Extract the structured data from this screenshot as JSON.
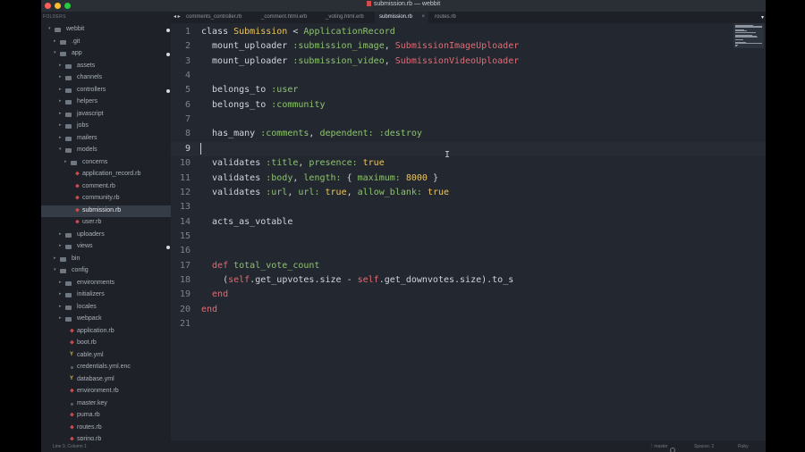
{
  "window": {
    "title": "submission.rb — webbit",
    "traffic_lights": [
      "#fc5f57",
      "#fdbc2e",
      "#28c840"
    ]
  },
  "sidebar": {
    "header": "FOLDERS",
    "items": [
      {
        "label": "webbit",
        "depth": 0,
        "kind": "folder-open",
        "dot": true
      },
      {
        "label": ".git",
        "depth": 1,
        "kind": "folder"
      },
      {
        "label": "app",
        "depth": 1,
        "kind": "folder-open",
        "dot": true
      },
      {
        "label": "assets",
        "depth": 2,
        "kind": "folder"
      },
      {
        "label": "channels",
        "depth": 2,
        "kind": "folder"
      },
      {
        "label": "controllers",
        "depth": 2,
        "kind": "folder",
        "dot": true
      },
      {
        "label": "helpers",
        "depth": 2,
        "kind": "folder"
      },
      {
        "label": "javascript",
        "depth": 2,
        "kind": "folder"
      },
      {
        "label": "jobs",
        "depth": 2,
        "kind": "folder"
      },
      {
        "label": "mailers",
        "depth": 2,
        "kind": "folder"
      },
      {
        "label": "models",
        "depth": 2,
        "kind": "folder-open"
      },
      {
        "label": "concerns",
        "depth": 3,
        "kind": "folder"
      },
      {
        "label": "application_record.rb",
        "depth": 3,
        "kind": "ruby"
      },
      {
        "label": "comment.rb",
        "depth": 3,
        "kind": "ruby"
      },
      {
        "label": "community.rb",
        "depth": 3,
        "kind": "ruby"
      },
      {
        "label": "submission.rb",
        "depth": 3,
        "kind": "ruby",
        "selected": true
      },
      {
        "label": "user.rb",
        "depth": 3,
        "kind": "ruby"
      },
      {
        "label": "uploaders",
        "depth": 2,
        "kind": "folder"
      },
      {
        "label": "views",
        "depth": 2,
        "kind": "folder",
        "dot": true
      },
      {
        "label": "bin",
        "depth": 1,
        "kind": "folder"
      },
      {
        "label": "config",
        "depth": 1,
        "kind": "folder-open"
      },
      {
        "label": "environments",
        "depth": 2,
        "kind": "folder"
      },
      {
        "label": "initializers",
        "depth": 2,
        "kind": "folder"
      },
      {
        "label": "locales",
        "depth": 2,
        "kind": "folder"
      },
      {
        "label": "webpack",
        "depth": 2,
        "kind": "folder"
      },
      {
        "label": "application.rb",
        "depth": 2,
        "kind": "ruby"
      },
      {
        "label": "boot.rb",
        "depth": 2,
        "kind": "ruby"
      },
      {
        "label": "cable.yml",
        "depth": 2,
        "kind": "yaml"
      },
      {
        "label": "credentials.yml.enc",
        "depth": 2,
        "kind": "generic"
      },
      {
        "label": "database.yml",
        "depth": 2,
        "kind": "yaml"
      },
      {
        "label": "environment.rb",
        "depth": 2,
        "kind": "ruby"
      },
      {
        "label": "master.key",
        "depth": 2,
        "kind": "generic"
      },
      {
        "label": "puma.rb",
        "depth": 2,
        "kind": "ruby"
      },
      {
        "label": "routes.rb",
        "depth": 2,
        "kind": "ruby"
      },
      {
        "label": "spring.rb",
        "depth": 2,
        "kind": "ruby"
      }
    ]
  },
  "tabs": {
    "nav": "◂ ▸",
    "items": [
      {
        "label": "comments_controller.rb"
      },
      {
        "label": "_comment.html.erb"
      },
      {
        "label": "_voting.html.erb"
      },
      {
        "label": "submission.rb",
        "active": true
      },
      {
        "label": "routes.rb"
      }
    ],
    "close_glyph": "×",
    "menu_glyph": "▾"
  },
  "editor": {
    "current_line": 9,
    "lines": [
      {
        "num": "1",
        "tokens": [
          [
            "k",
            "class "
          ],
          [
            "c",
            "Submission"
          ],
          [
            "k",
            " < "
          ],
          [
            "s",
            "ApplicationRecord"
          ]
        ]
      },
      {
        "num": "2",
        "tokens": [
          [
            "k",
            "  mount_uploader "
          ],
          [
            "s",
            ":submission_image"
          ],
          [
            "k",
            ", "
          ],
          [
            "e",
            "SubmissionImageUploader"
          ]
        ]
      },
      {
        "num": "3",
        "tokens": [
          [
            "k",
            "  mount_uploader "
          ],
          [
            "s",
            ":submission_video"
          ],
          [
            "k",
            ", "
          ],
          [
            "e",
            "SubmissionVideoUploader"
          ]
        ]
      },
      {
        "num": "4",
        "tokens": []
      },
      {
        "num": "5",
        "tokens": [
          [
            "k",
            "  belongs_to "
          ],
          [
            "s",
            ":user"
          ]
        ]
      },
      {
        "num": "6",
        "tokens": [
          [
            "k",
            "  belongs_to "
          ],
          [
            "s",
            ":community"
          ]
        ]
      },
      {
        "num": "7",
        "tokens": []
      },
      {
        "num": "8",
        "tokens": [
          [
            "k",
            "  has_many "
          ],
          [
            "s",
            ":comments"
          ],
          [
            "k",
            ", "
          ],
          [
            "s",
            "dependent:"
          ],
          [
            "k",
            " "
          ],
          [
            "s",
            ":destroy"
          ]
        ]
      },
      {
        "num": "9",
        "tokens": []
      },
      {
        "num": "10",
        "tokens": [
          [
            "k",
            "  validates "
          ],
          [
            "s",
            ":title"
          ],
          [
            "k",
            ", "
          ],
          [
            "s",
            "presence:"
          ],
          [
            "k",
            " "
          ],
          [
            "v",
            "true"
          ]
        ]
      },
      {
        "num": "11",
        "tokens": [
          [
            "k",
            "  validates "
          ],
          [
            "s",
            ":body"
          ],
          [
            "k",
            ", "
          ],
          [
            "s",
            "length:"
          ],
          [
            "k",
            " { "
          ],
          [
            "s",
            "maximum:"
          ],
          [
            "k",
            " "
          ],
          [
            "n",
            "8000"
          ],
          [
            "k",
            " }"
          ]
        ]
      },
      {
        "num": "12",
        "tokens": [
          [
            "k",
            "  validates "
          ],
          [
            "s",
            ":url"
          ],
          [
            "k",
            ", "
          ],
          [
            "s",
            "url:"
          ],
          [
            "k",
            " "
          ],
          [
            "v",
            "true"
          ],
          [
            "k",
            ", "
          ],
          [
            "s",
            "allow_blank:"
          ],
          [
            "k",
            " "
          ],
          [
            "v",
            "true"
          ]
        ]
      },
      {
        "num": "13",
        "tokens": []
      },
      {
        "num": "14",
        "tokens": [
          [
            "k",
            "  acts_as_votable"
          ]
        ]
      },
      {
        "num": "15",
        "tokens": []
      },
      {
        "num": "16",
        "tokens": []
      },
      {
        "num": "17",
        "tokens": [
          [
            "e",
            "  def "
          ],
          [
            "s",
            "total_vote_count"
          ]
        ]
      },
      {
        "num": "18",
        "tokens": [
          [
            "k",
            "    ("
          ],
          [
            "e",
            "self"
          ],
          [
            "k",
            ".get_upvotes.size - "
          ],
          [
            "e",
            "self"
          ],
          [
            "k",
            ".get_downvotes.size).to_s"
          ]
        ]
      },
      {
        "num": "19",
        "tokens": [
          [
            "e",
            "  end"
          ]
        ]
      },
      {
        "num": "20",
        "tokens": [
          [
            "e",
            "end"
          ]
        ]
      },
      {
        "num": "21",
        "tokens": []
      }
    ]
  },
  "statusbar": {
    "position": "Line 9, Column 1",
    "branch": "master",
    "spaces": "Spaces: 2",
    "syntax": "Ruby"
  },
  "colors": {
    "editor_bg": "#232830",
    "sidebar_bg": "#1e2228",
    "selected_row": "#363c46",
    "class_yellow": "#ecc55a",
    "symbol_green": "#8fc173",
    "constant_red": "#e06c75",
    "ruby_file_icon": "#cc4b4b"
  }
}
